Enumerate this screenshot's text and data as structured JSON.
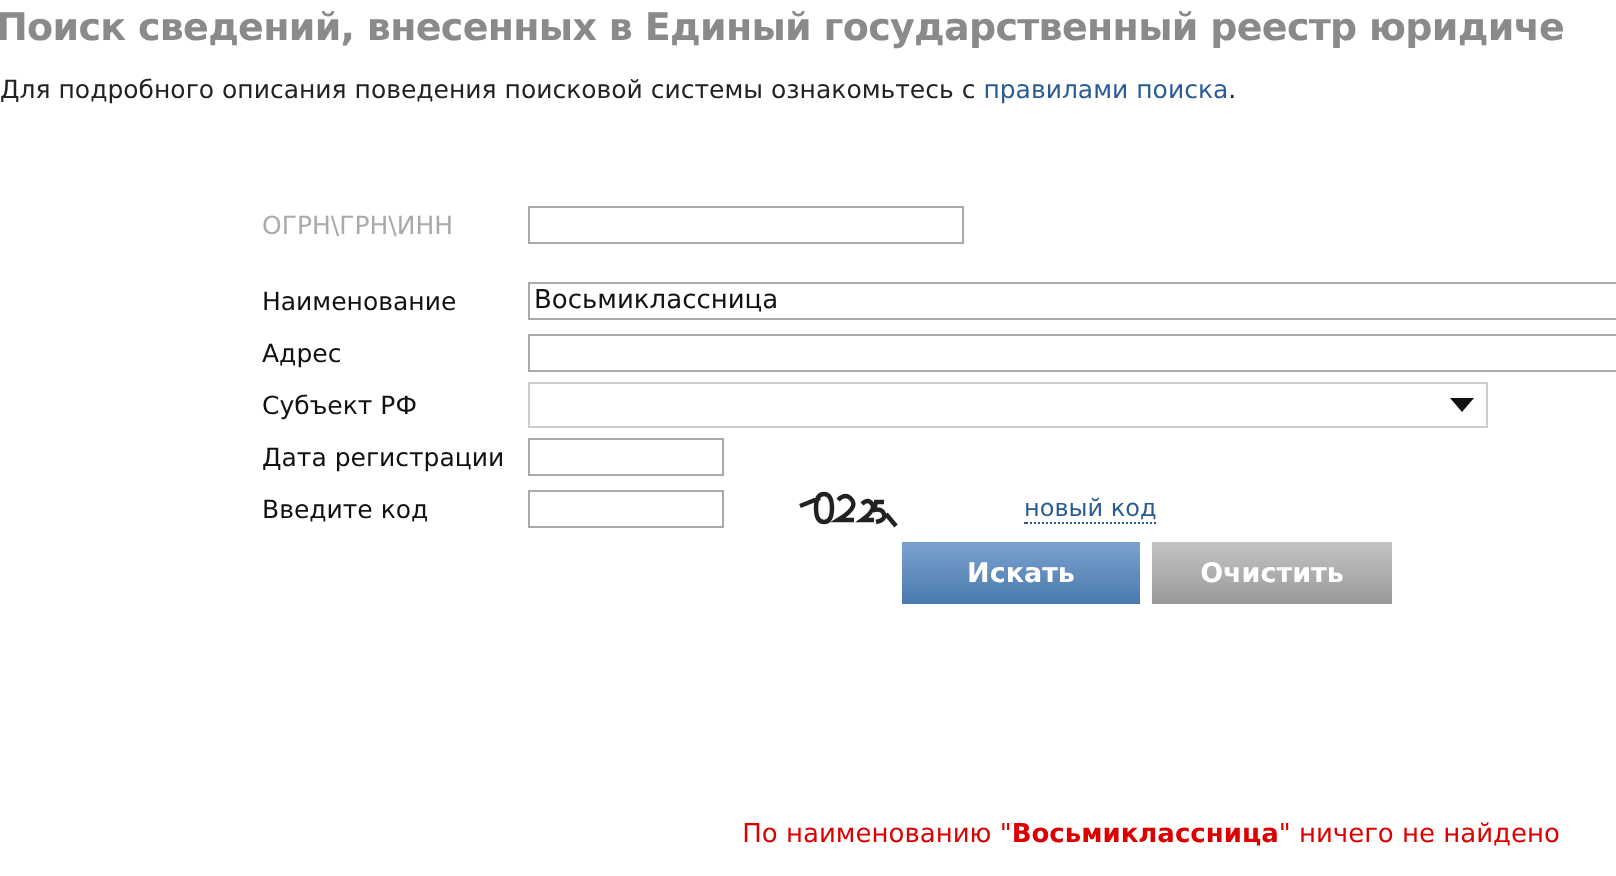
{
  "title": "Поиск сведений, внесенных в Единый государственный реестр юридиче",
  "intro": {
    "text": "Для подробного описания поведения поисковой системы ознакомьтесь с",
    "link": "правилами поиска",
    "tail": "."
  },
  "fields": [
    {
      "kind": "text",
      "label": "ОГРН\\ГРН\\ИНН",
      "disabled": true
    },
    {
      "kind": "text",
      "label": "Наименование",
      "disabled": false,
      "value": "Восьмиклассница"
    },
    {
      "kind": "text",
      "label": "Адрес",
      "disabled": false
    },
    {
      "kind": "select",
      "label": "Субъект РФ",
      "disabled": false
    },
    {
      "kind": "text",
      "label": "Дата регистрации",
      "disabled": false
    },
    {
      "kind": "captcha",
      "label": "Введите код",
      "disabled": false,
      "link": "новый код"
    }
  ],
  "buttons": [
    {
      "label": "Искать",
      "kind": "primary"
    },
    {
      "label": "Очистить",
      "kind": "secondary"
    }
  ],
  "result": "По наименованию \"**Восьмиклассница**\" ничего не найдено"
}
